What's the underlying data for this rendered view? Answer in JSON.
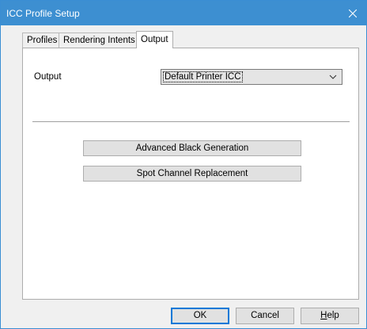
{
  "window": {
    "title": "ICC Profile Setup"
  },
  "tabs": [
    {
      "label": "Profiles",
      "active": false
    },
    {
      "label": "Rendering Intents",
      "active": false
    },
    {
      "label": "Output",
      "active": true
    }
  ],
  "output": {
    "label": "Output",
    "selected": "Default Printer ICC"
  },
  "buttons": {
    "advanced_black": "Advanced Black Generation",
    "spot_channel": "Spot Channel Replacement",
    "ok": "OK",
    "cancel": "Cancel",
    "help_prefix": "H",
    "help_rest": "elp"
  },
  "icons": {
    "close": "close-icon",
    "dropdown": "chevron-down-icon"
  },
  "colors": {
    "titlebar": "#3d8fd1",
    "default_button_border": "#0078d7"
  }
}
